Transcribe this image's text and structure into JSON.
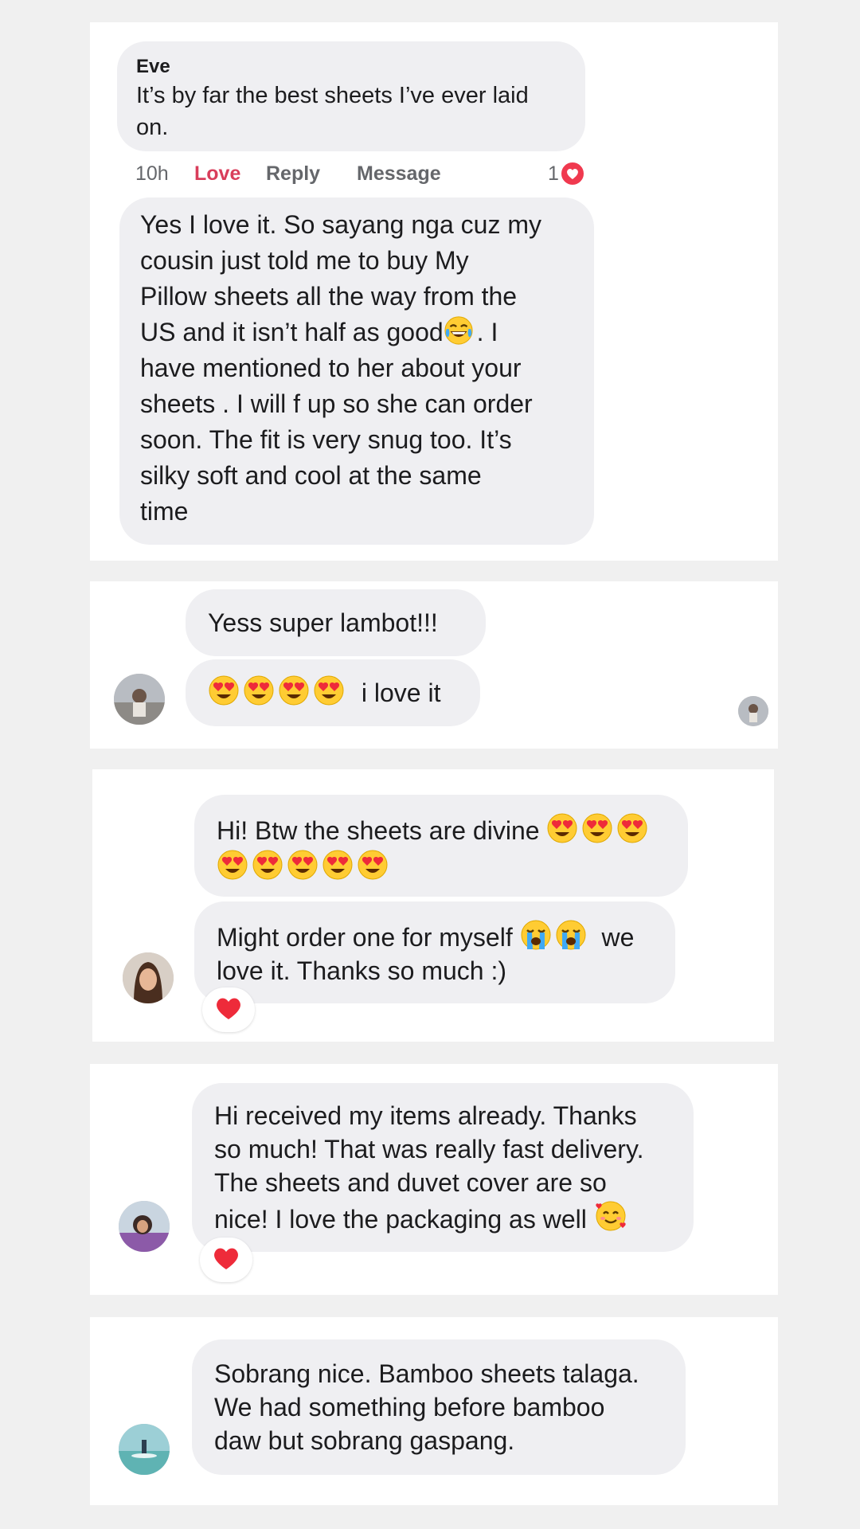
{
  "comment1": {
    "author": "Eve",
    "text_line1": "It’s by far the best sheets I’ve ever laid",
    "text_line2": "on.",
    "time": "10h",
    "love_label": "Love",
    "reply_label": "Reply",
    "message_label": "Message",
    "reaction_count": "1",
    "reply_lines": [
      "Yes I love it. So sayang nga cuz my",
      "cousin just told me to buy My",
      "Pillow sheets all the way from the",
      "US and it isn’t half as good",
      ". I",
      "have mentioned to her about your",
      "sheets . I will f up so she can order",
      "soon. The fit is very snug too. It’s",
      "silky soft and cool at the same",
      "time"
    ],
    "reply_emoji": "face-with-tears-of-joy-icon"
  },
  "chat2": {
    "msg1": "Yess super lambot!!!",
    "msg2_text": "i love it",
    "msg2_emoji": "heart-eyes-icon"
  },
  "chat3": {
    "msg1_text": "Hi! Btw the sheets are divine",
    "msg2_text1": "Might order one for myself",
    "msg2_text2": "we",
    "msg2_line2": "love it. Thanks so much :)",
    "reaction": "red-heart-icon"
  },
  "chat4": {
    "lines": [
      "Hi received my items already. Thanks",
      "so much! That was really fast delivery.",
      "The sheets and duvet cover are so",
      "nice! I love the packaging as well"
    ],
    "emoji": "smiling-face-with-hearts-icon",
    "reaction": "red-heart-icon"
  },
  "chat5": {
    "lines": [
      "Sobrang nice. Bamboo sheets talaga.",
      "We had something before bamboo",
      "daw but sobrang gaspang."
    ]
  },
  "colors": {
    "background": "#f0f0f0",
    "card": "#ffffff",
    "bubble": "#efeff2",
    "love": "#d93e5b",
    "meta": "#65676b",
    "heart": "#ee2b3a"
  }
}
